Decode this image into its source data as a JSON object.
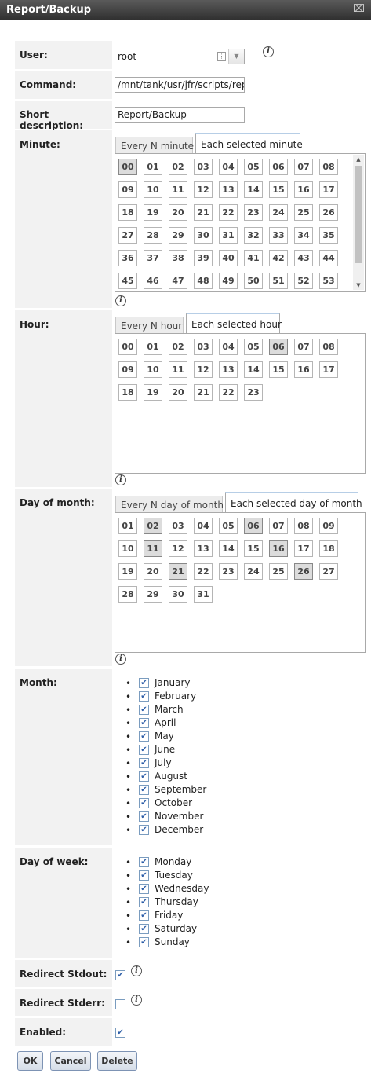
{
  "window": {
    "title": "Report/Backup",
    "close_icon": "close-icon"
  },
  "labels": {
    "user": "User:",
    "command": "Command:",
    "short_description": "Short description:",
    "minute": "Minute:",
    "hour": "Hour:",
    "day_of_month": "Day of month:",
    "month": "Month:",
    "day_of_week": "Day of week:",
    "redirect_stdout": "Redirect Stdout:",
    "redirect_stderr": "Redirect Stderr:",
    "enabled": "Enabled:"
  },
  "fields": {
    "user": "root",
    "command": "/mnt/tank/usr/jfr/scripts/rep",
    "short_description": "Report/Backup"
  },
  "tabs": {
    "minute": {
      "every_n": "Every N minute",
      "each_selected": "Each selected minute"
    },
    "hour": {
      "every_n": "Every N hour",
      "each_selected": "Each selected hour"
    },
    "day_of_month": {
      "every_n": "Every N day of month",
      "each_selected": "Each selected day of month"
    }
  },
  "minutes": [
    "00",
    "01",
    "02",
    "03",
    "04",
    "05",
    "06",
    "07",
    "08",
    "09",
    "10",
    "11",
    "12",
    "13",
    "14",
    "15",
    "16",
    "17",
    "18",
    "19",
    "20",
    "21",
    "22",
    "23",
    "24",
    "25",
    "26",
    "27",
    "28",
    "29",
    "30",
    "31",
    "32",
    "33",
    "34",
    "35",
    "36",
    "37",
    "38",
    "39",
    "40",
    "41",
    "42",
    "43",
    "44",
    "45",
    "46",
    "47",
    "48",
    "49",
    "50",
    "51",
    "52",
    "53"
  ],
  "minutes_selected": [
    "00"
  ],
  "hours": [
    "00",
    "01",
    "02",
    "03",
    "04",
    "05",
    "06",
    "07",
    "08",
    "09",
    "10",
    "11",
    "12",
    "13",
    "14",
    "15",
    "16",
    "17",
    "18",
    "19",
    "20",
    "21",
    "22",
    "23"
  ],
  "hours_selected": [
    "06"
  ],
  "days": [
    "01",
    "02",
    "03",
    "04",
    "05",
    "06",
    "07",
    "08",
    "09",
    "10",
    "11",
    "12",
    "13",
    "14",
    "15",
    "16",
    "17",
    "18",
    "19",
    "20",
    "21",
    "22",
    "23",
    "24",
    "25",
    "26",
    "27",
    "28",
    "29",
    "30",
    "31"
  ],
  "days_selected": [
    "02",
    "06",
    "11",
    "16",
    "21",
    "26"
  ],
  "months": [
    "January",
    "February",
    "March",
    "April",
    "May",
    "June",
    "July",
    "August",
    "September",
    "October",
    "November",
    "December"
  ],
  "weekdays": [
    "Monday",
    "Tuesday",
    "Wednesday",
    "Thursday",
    "Friday",
    "Saturday",
    "Sunday"
  ],
  "checkboxes": {
    "redirect_stdout": true,
    "redirect_stderr": false,
    "enabled": true
  },
  "buttons": {
    "ok": "OK",
    "cancel": "Cancel",
    "delete": "Delete"
  },
  "colors": {
    "titlebar": "#3d3d3d",
    "label_bg": "#f2f2f2",
    "selected_cell": "#dcdcdc",
    "button_border": "#7d93b4",
    "checkbox_border": "#7a9cbf"
  }
}
